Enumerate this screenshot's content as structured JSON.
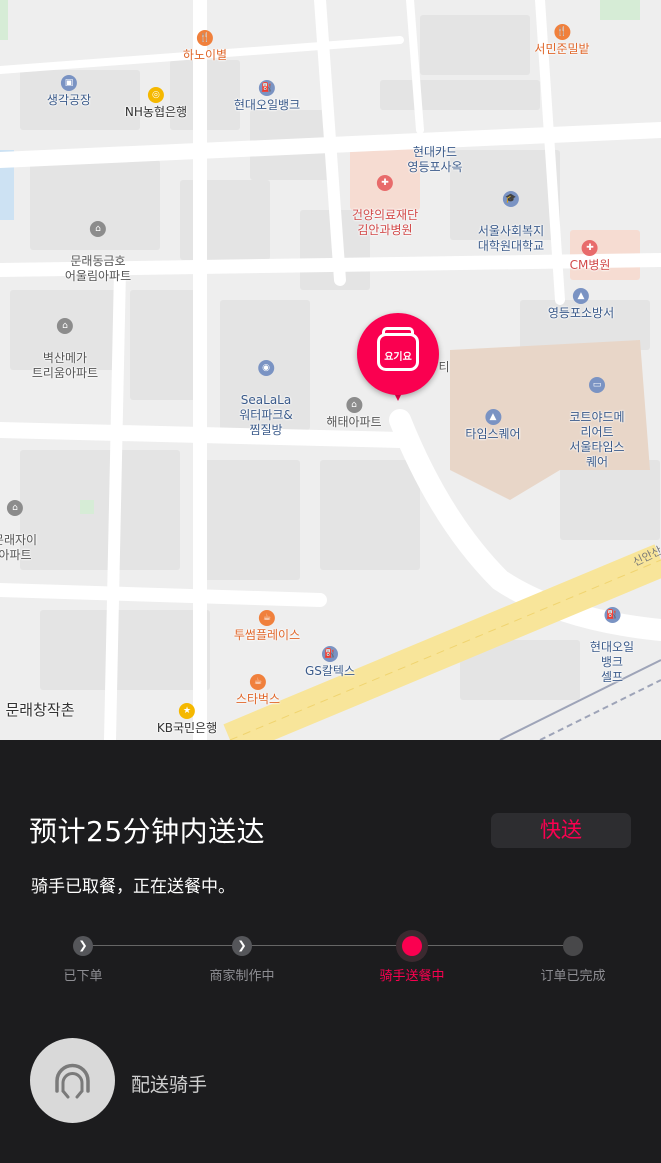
{
  "map": {
    "pois": [
      {
        "name": "하노이별",
        "color": "orange",
        "glyph": "🍴"
      },
      {
        "name": "서민준밀밭",
        "color": "orange",
        "glyph": "🍴"
      },
      {
        "name": "생각공장",
        "color": "blue",
        "glyph": "▣"
      },
      {
        "name": "NH농협은행",
        "color": "yellow",
        "glyph": "◎"
      },
      {
        "name": "현대오일뱅크",
        "color": "blue",
        "glyph": "⛽"
      },
      {
        "name": "현대카드\n영등포사옥",
        "color": "blue",
        "glyph": ""
      },
      {
        "name": "건양의료재단\n김안과병원",
        "color": "red",
        "glyph": "✚"
      },
      {
        "name": "서울사회복지\n대학원대학교",
        "color": "blue",
        "glyph": "🎓"
      },
      {
        "name": "문래동금호\n어울림아파트",
        "color": "gray",
        "glyph": "⌂"
      },
      {
        "name": "CM병원",
        "color": "red",
        "glyph": "✚"
      },
      {
        "name": "영등포소방서",
        "color": "blue",
        "glyph": "▲"
      },
      {
        "name": "벽산메가\n트리움아파트",
        "color": "gray",
        "glyph": "⌂"
      },
      {
        "name": "SeaLaLa\n워터파크&\n찜질방",
        "color": "blue",
        "glyph": "◉"
      },
      {
        "name": "코트야드메리어트\n서울타임스퀘어",
        "color": "blue",
        "glyph": "▭"
      },
      {
        "name": "해태아파트",
        "color": "gray",
        "glyph": "⌂"
      },
      {
        "name": "타임스퀘어",
        "color": "blue",
        "glyph": "▲"
      },
      {
        "name": "문래자이\n아파트",
        "color": "gray",
        "glyph": "⌂"
      },
      {
        "name": "현대오일뱅크\n셀프",
        "color": "blue",
        "glyph": "⛽"
      },
      {
        "name": "투썸플레이스",
        "color": "orange",
        "glyph": "☕"
      },
      {
        "name": "GS칼텍스",
        "color": "blue",
        "glyph": "⛽"
      },
      {
        "name": "스타벅스",
        "color": "orange",
        "glyph": "☕"
      },
      {
        "name": "KB국민은행",
        "color": "yellow",
        "glyph": "★"
      }
    ],
    "area_label": "문래창작촌",
    "street_label": "신안산",
    "partial_label": "티",
    "pin_brand": "요기요"
  },
  "order": {
    "eta": "预计25分钟内送达",
    "badge": "快送",
    "status": "骑手已取餐，正在送餐中。"
  },
  "steps": [
    {
      "label": "已下单",
      "state": "done",
      "glyph": "❯"
    },
    {
      "label": "商家制作中",
      "state": "done",
      "glyph": "❯"
    },
    {
      "label": "骑手送餐中",
      "state": "active",
      "glyph": ""
    },
    {
      "label": "订单已完成",
      "state": "pending",
      "glyph": ""
    }
  ],
  "rider": {
    "label": "配送骑手",
    "icon": "rider-helmet-icon"
  },
  "colors": {
    "accent": "#fa0050",
    "panel_bg": "#1c1c1e",
    "badge_bg": "#2d2d30"
  }
}
